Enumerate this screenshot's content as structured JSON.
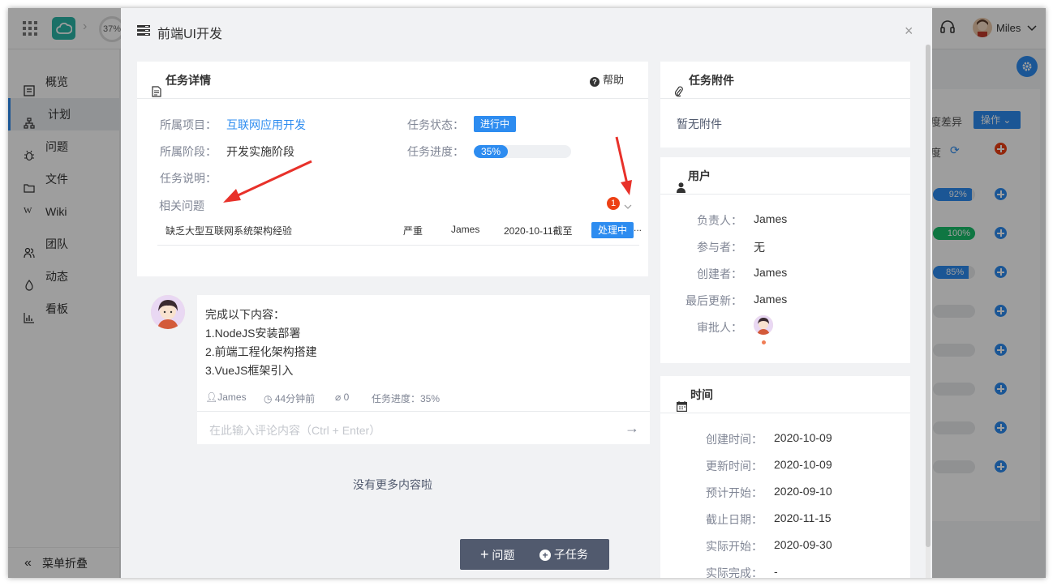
{
  "app": {
    "breadcrumb_percent": "37%",
    "user_name": "Miles"
  },
  "sidebar": {
    "items": [
      {
        "label": "概览",
        "icon": "overview-icon"
      },
      {
        "label": "计划",
        "icon": "plan-icon"
      },
      {
        "label": "问题",
        "icon": "bug-icon"
      },
      {
        "label": "文件",
        "icon": "folder-icon"
      },
      {
        "label": "Wiki",
        "icon": "wiki-icon"
      },
      {
        "label": "团队",
        "icon": "team-icon"
      },
      {
        "label": "动态",
        "icon": "activity-icon"
      },
      {
        "label": "看板",
        "icon": "board-icon"
      }
    ],
    "collapse_label": "菜单折叠"
  },
  "background_table": {
    "col_header": "度差异",
    "col_sub": "度",
    "op_label": "操作",
    "progress": [
      {
        "label": "92%",
        "value": 92,
        "color": "#2d8cf0"
      },
      {
        "label": "100%",
        "value": 100,
        "color": "#19be6b"
      },
      {
        "label": "85%",
        "value": 85,
        "color": "#2d8cf0"
      }
    ]
  },
  "modal": {
    "title": "前端UI开发",
    "close": "×",
    "details": {
      "heading": "任务详情",
      "help": "帮助",
      "project_label": "所属项目：",
      "project_value": "互联网应用开发",
      "status_label": "任务状态：",
      "status_value": "进行中",
      "stage_label": "所属阶段：",
      "stage_value": "开发实施阶段",
      "progress_label": "任务进度：",
      "progress_value": "35%",
      "progress_number": 35,
      "desc_label": "任务说明：",
      "related_label": "相关问题",
      "related_count": "1",
      "issue": {
        "title": "缺乏大型互联网系统架构经验",
        "severity": "严重",
        "owner": "James",
        "deadline": "2020-10-11截至",
        "status": "处理中",
        "more": "..."
      }
    },
    "comment": {
      "lines": [
        "完成以下内容：",
        "1.NodeJS安装部署",
        "2.前端工程化架构搭建",
        "3.VueJS框架引入"
      ],
      "author": "James",
      "time": "44分钟前",
      "attachments": "0",
      "progress": "任务进度：35%",
      "input_placeholder": "在此输入评论内容（Ctrl + Enter）"
    },
    "no_more": "没有更多内容啦",
    "actions": {
      "issue": "问题",
      "subtask": "子任务"
    },
    "attachments": {
      "heading": "任务附件",
      "empty": "暂无附件"
    },
    "users": {
      "heading": "用户",
      "rows": [
        {
          "label": "负责人：",
          "value": "James"
        },
        {
          "label": "参与者：",
          "value": "无"
        },
        {
          "label": "创建者：",
          "value": "James"
        },
        {
          "label": "最后更新：",
          "value": "James"
        },
        {
          "label": "审批人：",
          "value": ""
        }
      ]
    },
    "time": {
      "heading": "时间",
      "rows": [
        {
          "label": "创建时间：",
          "value": "2020-10-09"
        },
        {
          "label": "更新时间：",
          "value": "2020-10-09"
        },
        {
          "label": "预计开始：",
          "value": "2020-09-10"
        },
        {
          "label": "截止日期：",
          "value": "2020-11-15"
        },
        {
          "label": "实际开始：",
          "value": "2020-09-30"
        },
        {
          "label": "实际完成：",
          "value": "-"
        }
      ]
    }
  }
}
